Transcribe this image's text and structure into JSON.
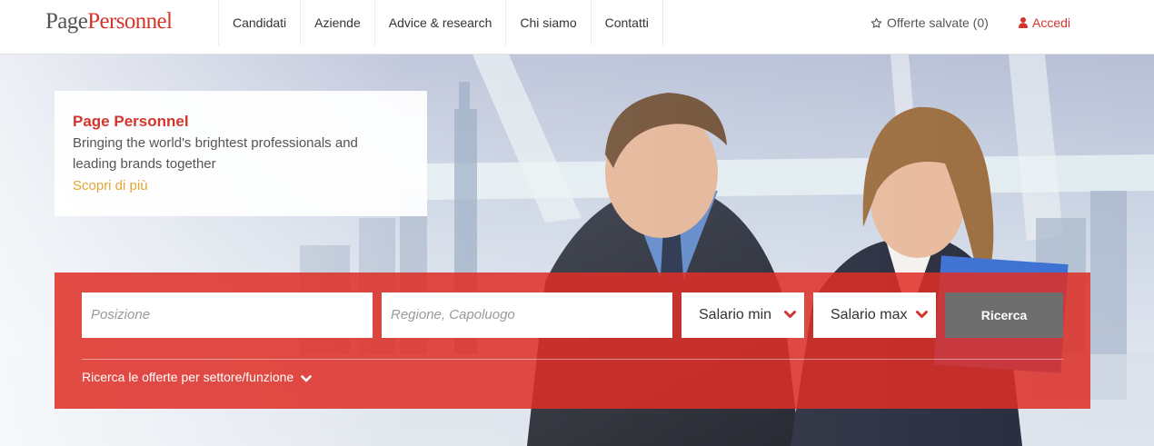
{
  "header": {
    "logo": {
      "part1": "Page",
      "part2": "Personnel"
    },
    "nav": [
      "Candidati",
      "Aziende",
      "Advice & research",
      "Chi siamo",
      "Contatti"
    ],
    "saved_jobs": "Offerte salvate (0)",
    "login": "Accedi"
  },
  "promo": {
    "title": "Page Personnel",
    "text": "Bringing the world's brightest professionals and leading brands together",
    "link": "Scopri di più"
  },
  "search": {
    "position_placeholder": "Posizione",
    "location_placeholder": "Regione, Capoluogo",
    "salary_min": "Salario min",
    "salary_max": "Salario max",
    "button": "Ricerca",
    "sector_link": "Ricerca le offerte per settore/funzione"
  },
  "colors": {
    "brand_red": "#d3352c",
    "link_gold": "#e6a531",
    "button_gray": "#6e6e6e"
  },
  "icons": [
    "star-icon",
    "user-icon",
    "chevron-down-icon"
  ]
}
